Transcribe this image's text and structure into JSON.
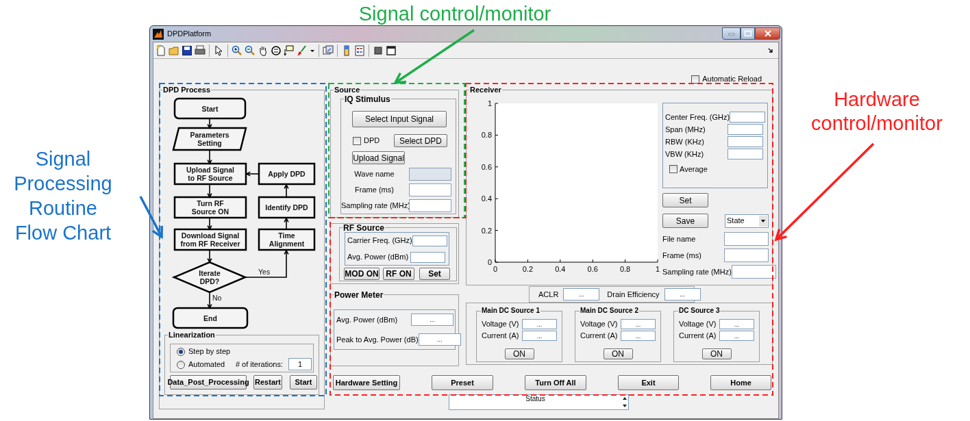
{
  "annotations": [
    {
      "lines": [
        "Signal control/monitor"
      ],
      "color": "#1fae4b"
    },
    {
      "lines": [
        "Signal",
        "Processing",
        "Routine",
        "Flow Chart"
      ],
      "color": "#1a74cc"
    },
    {
      "lines": [
        "Hardware",
        "control/monitor"
      ],
      "color": "#ff1f1f"
    }
  ],
  "window": {
    "title": "DPDPlatform"
  },
  "automatic_reload": {
    "label": "Automatic Reload",
    "checked": false
  },
  "dpd_process": {
    "title": "DPD Process",
    "flowchart": {
      "nodes": [
        {
          "kind": "terminal",
          "lines": [
            "Start"
          ]
        },
        {
          "kind": "input",
          "lines": [
            "Parameters",
            "Setting"
          ]
        },
        {
          "kind": "process",
          "lines": [
            "Upload Signal",
            "to RF Source"
          ]
        },
        {
          "kind": "process",
          "lines": [
            "Apply DPD"
          ]
        },
        {
          "kind": "process",
          "lines": [
            "Turn RF",
            "Source ON"
          ]
        },
        {
          "kind": "process",
          "lines": [
            "Identify DPD"
          ]
        },
        {
          "kind": "process",
          "lines": [
            "Download Signal",
            "from RF Receiver"
          ]
        },
        {
          "kind": "process",
          "lines": [
            "Time",
            "Alignment"
          ]
        },
        {
          "kind": "decision",
          "lines": [
            "Iterate",
            "DPD?"
          ]
        },
        {
          "kind": "terminal",
          "lines": [
            "End"
          ]
        }
      ],
      "edge_labels": [
        "Yes",
        "No"
      ]
    },
    "linearization": {
      "title": "Linearization",
      "options": [
        {
          "label": "Step by step",
          "selected": true
        },
        {
          "label": "Automated",
          "selected": false
        }
      ],
      "iterations_label": "# of iterations:",
      "iterations": "1",
      "buttons": [
        "Data_Post_Processing",
        "Restart",
        "Start"
      ]
    }
  },
  "source": {
    "title": "Source",
    "iq_stimulus": {
      "title": "IQ Stimulus",
      "select_input_button": "Select Input Signal",
      "dpd_checkbox": {
        "label": "DPD",
        "checked": false
      },
      "select_dpd_button": "Select DPD",
      "upload_button": "Upload Signal",
      "fields": [
        {
          "label": "Wave name",
          "disabled": true
        },
        {
          "label": "Frame (ms)",
          "disabled": false
        },
        {
          "label": "Sampling rate (MHz)",
          "disabled": false
        }
      ]
    }
  },
  "rf_source": {
    "title": "RF Source",
    "fields": [
      {
        "label": "Carrier Freq. (GHz)"
      },
      {
        "label": "Avg. Power (dBm)"
      }
    ],
    "buttons": [
      "MOD ON",
      "RF ON",
      "Set"
    ]
  },
  "power_meter": {
    "title": "Power Meter",
    "fields": [
      {
        "label": "Avg. Power (dBm)",
        "value": "..."
      },
      {
        "label": "Peak to Avg. Power (dB)",
        "value": "..."
      }
    ]
  },
  "receiver": {
    "title": "Receiver",
    "chart_data": {
      "type": "line",
      "xlim": [
        0,
        1
      ],
      "ylim": [
        0,
        1
      ],
      "xticks": [
        0,
        0.2,
        0.4,
        0.6,
        0.8,
        1
      ],
      "yticks": [
        0,
        0.2,
        0.4,
        0.6,
        0.8,
        1
      ]
    },
    "settings": [
      {
        "label": "Center Freq. (GHz)"
      },
      {
        "label": "Span (MHz)"
      },
      {
        "label": "RBW (KHz)"
      },
      {
        "label": "VBW (KHz)"
      }
    ],
    "average": {
      "label": "Average",
      "checked": false
    },
    "set_button": "Set",
    "save_button": "Save",
    "state_dropdown": "State",
    "save_fields": [
      {
        "label": "File name"
      },
      {
        "label": "Frame (ms)"
      },
      {
        "label": "Sampling rate (MHz)"
      }
    ]
  },
  "metrics": [
    {
      "label": "ACLR",
      "value": "..."
    },
    {
      "label": "Drain Efficiency",
      "value": "..."
    }
  ],
  "dc_sources": [
    {
      "title": "Main DC Source 1",
      "voltage_label": "Voltage (V)",
      "voltage": "...",
      "current_label": "Current (A)",
      "current": "...",
      "button": "ON"
    },
    {
      "title": "Main DC Source 2",
      "voltage_label": "Voltage (V)",
      "voltage": "...",
      "current_label": "Current (A)",
      "current": "...",
      "button": "ON"
    },
    {
      "title": "DC Source 3",
      "voltage_label": "Voltage (V)",
      "voltage": "...",
      "current_label": "Current (A)",
      "current": "...",
      "button": "ON"
    }
  ],
  "bottom_buttons": [
    "Hardware Setting",
    "Preset",
    "Turn Off All",
    "Exit",
    "Home"
  ],
  "status": {
    "label": "Status"
  }
}
